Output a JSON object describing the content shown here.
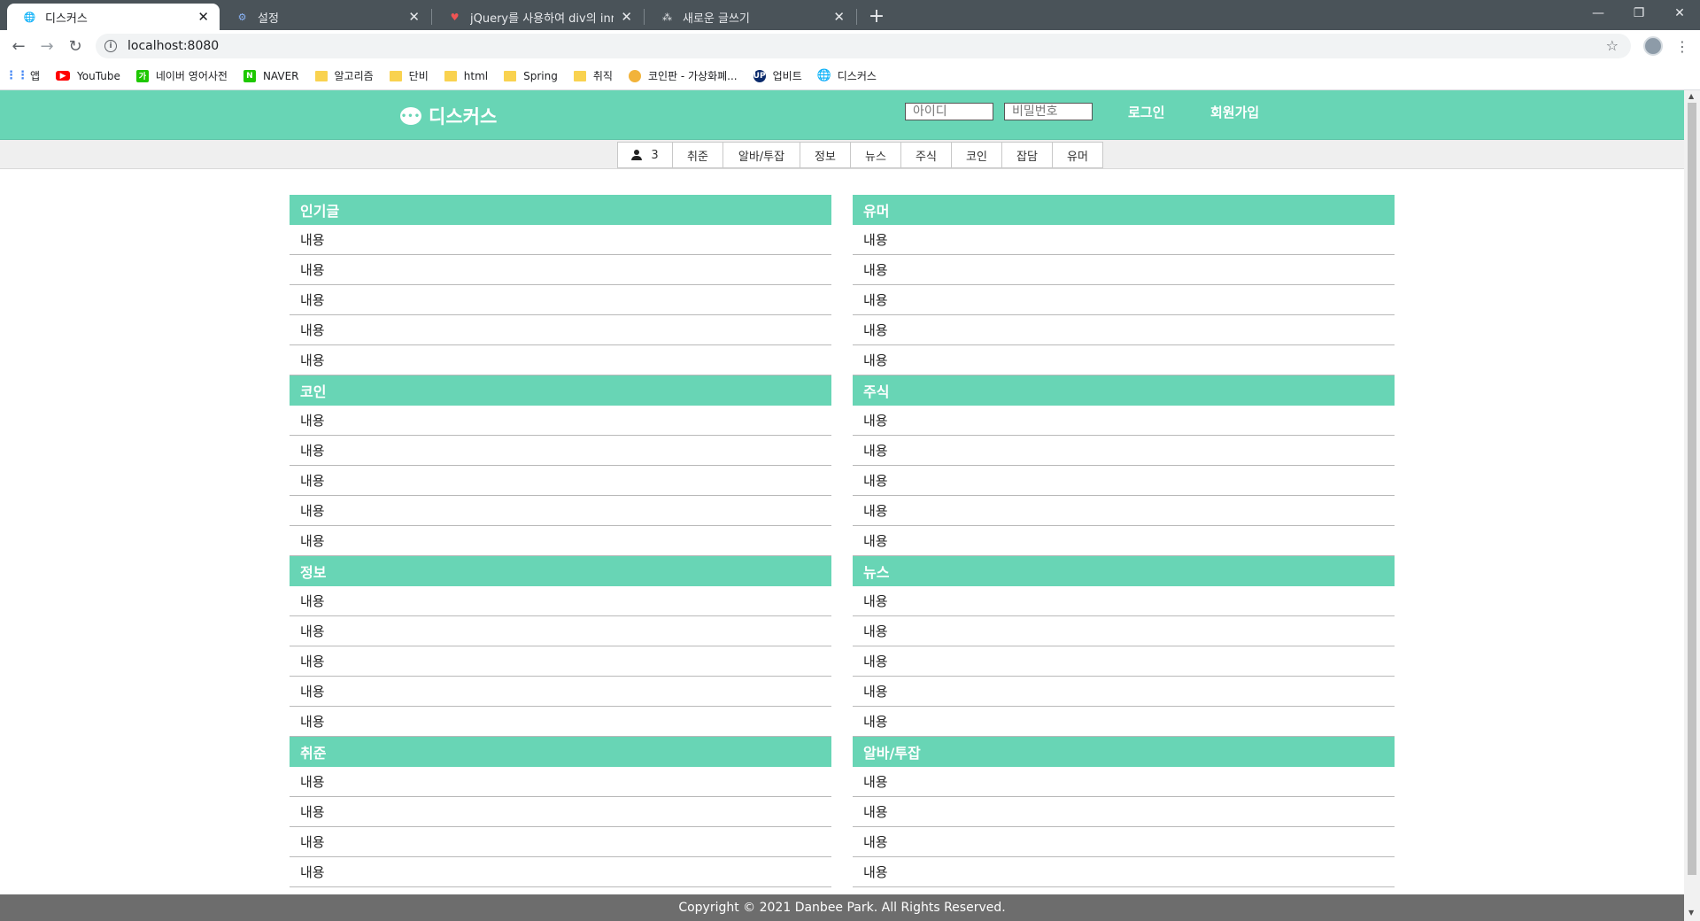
{
  "browser": {
    "tabs": [
      {
        "title": "디스커스",
        "icon": "globe-icon",
        "active": true
      },
      {
        "title": "설정",
        "icon": "gear-icon",
        "active": false
      },
      {
        "title": "jQuery를 사용하여 div의 innerH",
        "icon": "heart-icon",
        "active": false
      },
      {
        "title": "새로운 글쓰기",
        "icon": "tistory-icon",
        "active": false
      }
    ],
    "new_tab": "+",
    "url": "localhost:8080",
    "bookmarks": [
      {
        "label": "앱",
        "icon": "apps-icon"
      },
      {
        "label": "YouTube",
        "icon": "youtube-icon"
      },
      {
        "label": "네이버 영어사전",
        "icon": "naver-dict-icon"
      },
      {
        "label": "NAVER",
        "icon": "naver-icon"
      },
      {
        "label": "알고리즘",
        "icon": "folder-icon"
      },
      {
        "label": "단비",
        "icon": "folder-icon"
      },
      {
        "label": "html",
        "icon": "folder-icon"
      },
      {
        "label": "Spring",
        "icon": "folder-icon"
      },
      {
        "label": "취직",
        "icon": "folder-icon"
      },
      {
        "label": "코인판 - 가상화폐...",
        "icon": "coinpan-icon"
      },
      {
        "label": "업비트",
        "icon": "upbit-icon"
      },
      {
        "label": "디스커스",
        "icon": "globe-icon"
      }
    ]
  },
  "site": {
    "logo": "디스커스",
    "id_placeholder": "아이디",
    "pw_placeholder": "비밀번호",
    "login": "로그인",
    "signup": "회원가입",
    "nav": {
      "online_count": "3",
      "items": [
        "취준",
        "알바/투잡",
        "정보",
        "뉴스",
        "주식",
        "코인",
        "잡담",
        "유머"
      ]
    },
    "boards_left": [
      {
        "title": "인기글",
        "rows": [
          "내용",
          "내용",
          "내용",
          "내용",
          "내용"
        ]
      },
      {
        "title": "코인",
        "rows": [
          "내용",
          "내용",
          "내용",
          "내용",
          "내용"
        ]
      },
      {
        "title": "정보",
        "rows": [
          "내용",
          "내용",
          "내용",
          "내용",
          "내용"
        ]
      },
      {
        "title": "취준",
        "rows": [
          "내용",
          "내용",
          "내용",
          "내용"
        ]
      }
    ],
    "boards_right": [
      {
        "title": "유머",
        "rows": [
          "내용",
          "내용",
          "내용",
          "내용",
          "내용"
        ]
      },
      {
        "title": "주식",
        "rows": [
          "내용",
          "내용",
          "내용",
          "내용",
          "내용"
        ]
      },
      {
        "title": "뉴스",
        "rows": [
          "내용",
          "내용",
          "내용",
          "내용",
          "내용"
        ]
      },
      {
        "title": "알바/투잡",
        "rows": [
          "내용",
          "내용",
          "내용",
          "내용"
        ]
      }
    ],
    "footer": "Copyright © 2021 Danbee Park. All Rights Reserved."
  }
}
